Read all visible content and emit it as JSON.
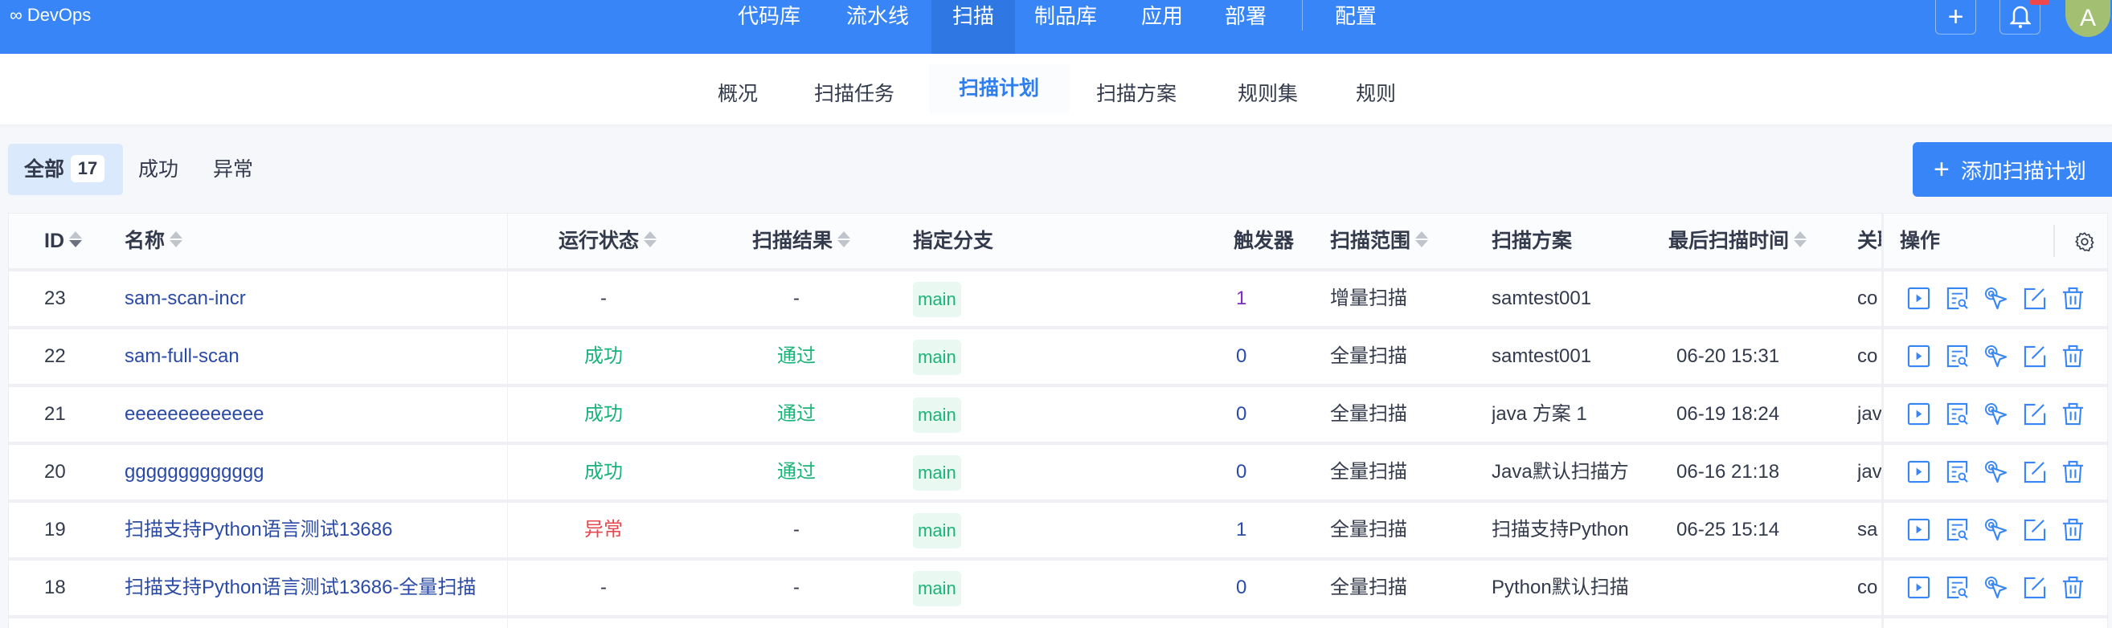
{
  "app": {
    "logo": "∞",
    "title": "DevOps"
  },
  "topnav": {
    "items": [
      "代码库",
      "流水线",
      "扫描",
      "制品库",
      "应用",
      "部署"
    ],
    "config": "配置",
    "active": "扫描",
    "plus_icon": "plus-icon",
    "bell_icon": "bell-icon",
    "avatar": "A"
  },
  "subnav": {
    "items": [
      "概况",
      "扫描任务",
      "扫描计划",
      "扫描方案",
      "规则集",
      "规则"
    ],
    "active": "扫描计划"
  },
  "filters": {
    "all": "全部",
    "all_count": "17",
    "success": "成功",
    "error": "异常"
  },
  "add_button": "添加扫描计划",
  "table": {
    "headers": {
      "id": "ID",
      "name": "名称",
      "run_status": "运行状态",
      "result": "扫描结果",
      "branch": "指定分支",
      "trigger": "触发器",
      "scope": "扫描范围",
      "scheme": "扫描方案",
      "last_time": "最后扫描时间",
      "related": "关联",
      "actions": "操作"
    },
    "rows": [
      {
        "id": "23",
        "name": "sam-scan-incr",
        "status": "-",
        "result": "-",
        "branch": "main",
        "trigger": "1",
        "scope": "增量扫描",
        "scheme": "samtest001",
        "time": "",
        "related": "co"
      },
      {
        "id": "22",
        "name": "sam-full-scan",
        "status": "成功",
        "result": "通过",
        "branch": "main",
        "trigger": "0",
        "scope": "全量扫描",
        "scheme": "samtest001",
        "time": "06-20 15:31",
        "related": "co"
      },
      {
        "id": "21",
        "name": "eeeeeeeeeeeee",
        "status": "成功",
        "result": "通过",
        "branch": "main",
        "trigger": "0",
        "scope": "全量扫描",
        "scheme": "java 方案 1",
        "time": "06-19 18:24",
        "related": "jav"
      },
      {
        "id": "20",
        "name": "ggggggggggggg",
        "status": "成功",
        "result": "通过",
        "branch": "main",
        "trigger": "0",
        "scope": "全量扫描",
        "scheme": "Java默认扫描方",
        "time": "06-16 21:18",
        "related": "jav"
      },
      {
        "id": "19",
        "name": "扫描支持Python语言测试13686",
        "status": "异常",
        "result": "-",
        "branch": "main",
        "trigger": "1",
        "scope": "全量扫描",
        "scheme": "扫描支持Python",
        "time": "06-25 15:14",
        "related": "sa"
      },
      {
        "id": "18",
        "name": "扫描支持Python语言测试13686-全量扫描",
        "status": "-",
        "result": "-",
        "branch": "main",
        "trigger": "0",
        "scope": "全量扫描",
        "scheme": "Python默认扫描",
        "time": "",
        "related": "co"
      }
    ]
  },
  "colors": {
    "primary": "#3885f8",
    "success": "#1bb37a",
    "error": "#e5484d",
    "link": "#2a4aa6"
  }
}
